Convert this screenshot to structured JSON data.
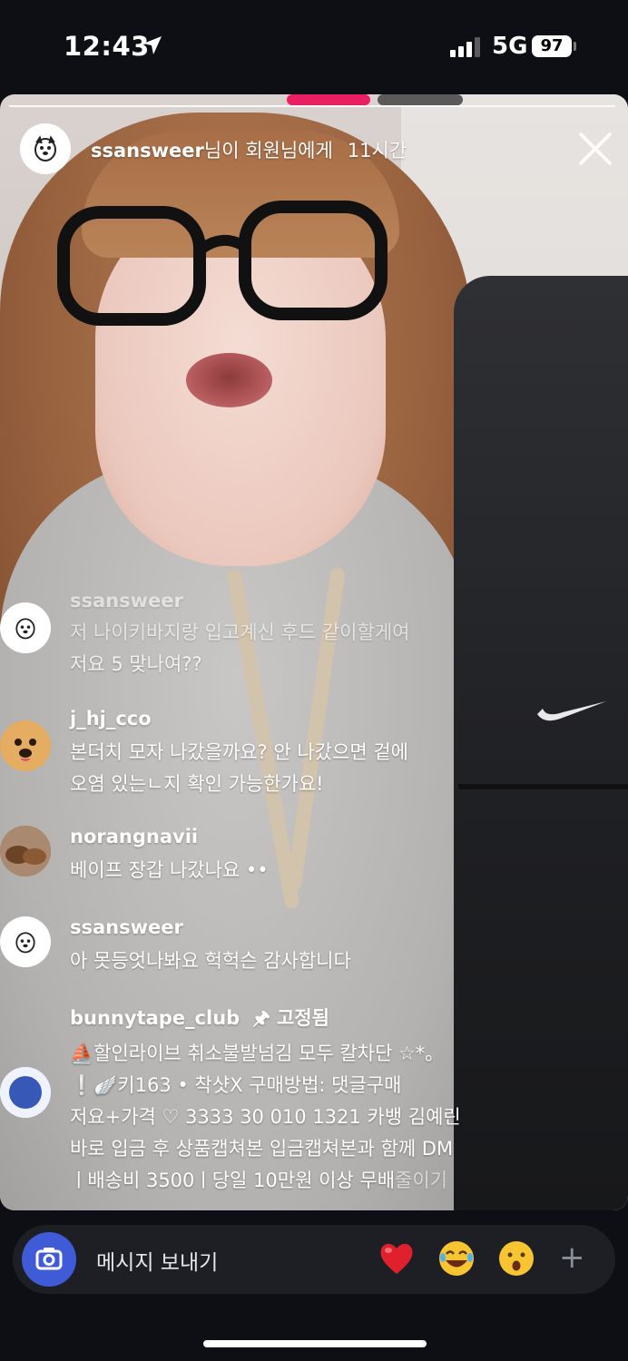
{
  "status_bar": {
    "time": "12:43",
    "network": "5G",
    "battery": "97"
  },
  "story": {
    "header": {
      "username": "ssansweer",
      "subtitle": "님이 회원님에게",
      "time_ago": "11시간"
    },
    "progress_segments": 2,
    "active_segment": 1
  },
  "comments": [
    {
      "user": "ssansweer",
      "lines": [
        "저 나이키바지랑 입고계신 후드 같이할게여",
        "저요 5 맞나여??"
      ]
    },
    {
      "user": "j_hj_cco",
      "lines": [
        "본더치 모자 나갔을까요? 안 나갔으면 겉에",
        "오염 있는ㄴ지 확인 가능한가요!"
      ]
    },
    {
      "user": "norangnavii",
      "lines": [
        "베이프 장갑 나갔나요 ••"
      ]
    },
    {
      "user": "ssansweer",
      "lines": [
        "아 못등엇나봐요 헉헉슨 감사합니다"
      ]
    },
    {
      "user": "bunnytape_club",
      "pinned_label": "고정됨",
      "lines": [
        "⛵할인라이브 취소불발넘김 모두 칼차단 ☆*。",
        "❕🪽키163 • 착샷X 구매방법: 댓글구매",
        "저요+가격 ♡ 3333 30 010 1321 카뱅 김예린",
        "바로 입금 후 상품캡쳐본 입금캡쳐본과 함께 DM",
        "ㅣ배송비 3500ㅣ당일 10만원 이상 무배"
      ],
      "more_label": "줄이기"
    }
  ],
  "composer": {
    "placeholder": "메시지 보내기",
    "emojis": [
      "❤️",
      "😂",
      "😮"
    ],
    "add_label": "+"
  },
  "colors": {
    "progress_active": "#e91e63",
    "camera_button": "#3f5bd8",
    "composer_bg": "#1d1f25"
  },
  "icons": [
    "location-arrow-icon",
    "signal-icon",
    "battery-icon",
    "close-icon",
    "camera-icon",
    "plus-icon",
    "pin-icon"
  ]
}
